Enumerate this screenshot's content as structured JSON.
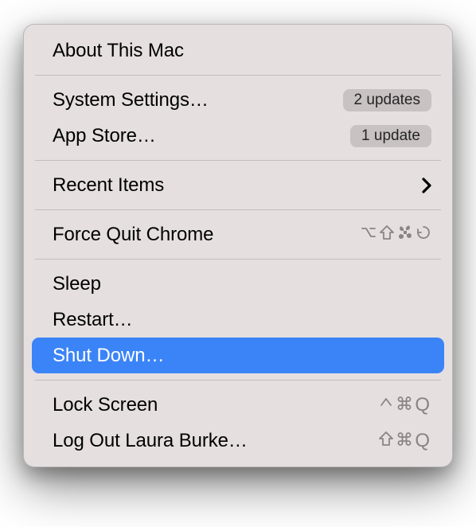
{
  "menu": {
    "about_label": "About This Mac",
    "system_settings_label": "System Settings…",
    "system_settings_badge": "2 updates",
    "app_store_label": "App Store…",
    "app_store_badge": "1 update",
    "recent_items_label": "Recent Items",
    "force_quit_label": "Force Quit Chrome",
    "force_quit_shortcut": [
      "option",
      "shift",
      "command",
      "escape"
    ],
    "sleep_label": "Sleep",
    "restart_label": "Restart…",
    "shut_down_label": "Shut Down…",
    "lock_screen_label": "Lock Screen",
    "lock_screen_shortcut": [
      "control",
      "command",
      "Q"
    ],
    "log_out_label": "Log Out Laura Burke…",
    "log_out_shortcut": [
      "shift",
      "command",
      "Q"
    ],
    "highlighted": "shut_down"
  },
  "colors": {
    "menu_bg": "#e5dfe0",
    "highlight": "#3b84f7",
    "shortcut_text": "#8b8486",
    "badge_bg": "#c8c2c3"
  }
}
